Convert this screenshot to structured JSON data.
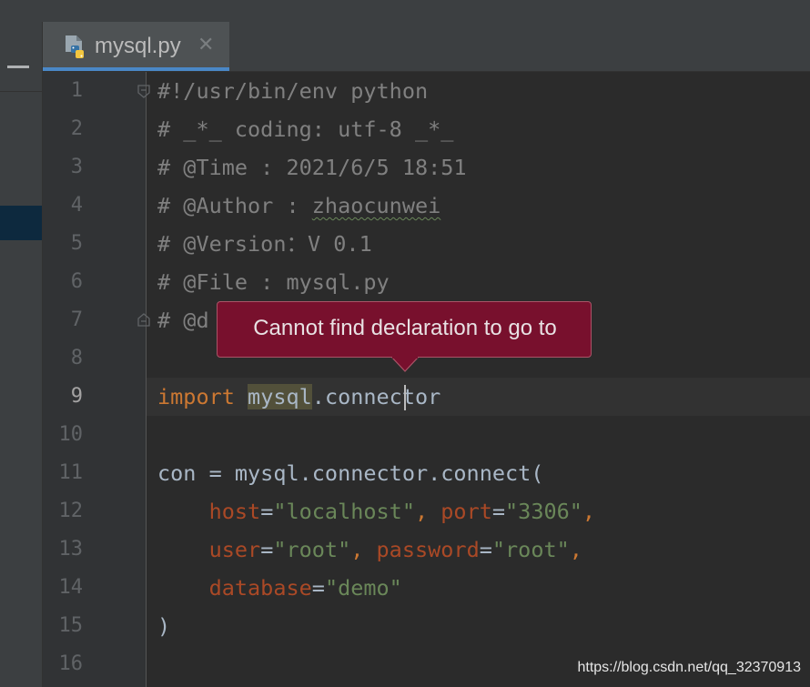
{
  "tab": {
    "label": "mysql.py",
    "close": "✕",
    "icon": "python-file-icon"
  },
  "colors": {
    "comment": "#808080",
    "keyword": "#cc7832",
    "string": "#6a8759",
    "parameter": "#aa4926",
    "default": "#a9b7c6",
    "tooltip_bg": "#78102d",
    "tab_underline": "#4a88c7"
  },
  "editor": {
    "active_line": "9",
    "lines": [
      {
        "n": "1",
        "tokens": [
          {
            "t": "#!/usr/bin/env python",
            "k": "comment"
          }
        ]
      },
      {
        "n": "2",
        "tokens": [
          {
            "t": "# _*_ coding: utf-8 _*_",
            "k": "comment"
          }
        ]
      },
      {
        "n": "3",
        "tokens": [
          {
            "t": "# @Time : 2021/6/5 18:51",
            "k": "comment"
          }
        ]
      },
      {
        "n": "4",
        "tokens": [
          {
            "t": "# @Author : ",
            "k": "comment"
          },
          {
            "t": "zhaocunwei",
            "k": "comment typo"
          }
        ]
      },
      {
        "n": "5",
        "tokens": [
          {
            "t": "# @Version：V 0.1",
            "k": "comment"
          }
        ]
      },
      {
        "n": "6",
        "tokens": [
          {
            "t": "# @File : mysql.py",
            "k": "comment"
          }
        ]
      },
      {
        "n": "7",
        "tokens": [
          {
            "t": "# @d",
            "k": "comment"
          }
        ]
      },
      {
        "n": "8",
        "tokens": []
      },
      {
        "n": "9",
        "tokens": [
          {
            "t": "import",
            "k": "keyword"
          },
          {
            "t": " ",
            "k": "default"
          },
          {
            "t": "mysql",
            "k": "default highlight"
          },
          {
            "t": ".connector",
            "k": "default"
          }
        ]
      },
      {
        "n": "10",
        "tokens": []
      },
      {
        "n": "11",
        "tokens": [
          {
            "t": "con = mysql.connector.connect(",
            "k": "default"
          }
        ]
      },
      {
        "n": "12",
        "tokens": [
          {
            "t": "    ",
            "k": "default"
          },
          {
            "t": "host",
            "k": "param"
          },
          {
            "t": "=",
            "k": "default"
          },
          {
            "t": "\"localhost\"",
            "k": "string"
          },
          {
            "t": ", ",
            "k": "keyword"
          },
          {
            "t": "port",
            "k": "param"
          },
          {
            "t": "=",
            "k": "default"
          },
          {
            "t": "\"3306\"",
            "k": "string"
          },
          {
            "t": ",",
            "k": "keyword"
          }
        ]
      },
      {
        "n": "13",
        "tokens": [
          {
            "t": "    ",
            "k": "default"
          },
          {
            "t": "user",
            "k": "param"
          },
          {
            "t": "=",
            "k": "default"
          },
          {
            "t": "\"root\"",
            "k": "string"
          },
          {
            "t": ", ",
            "k": "keyword"
          },
          {
            "t": "password",
            "k": "param"
          },
          {
            "t": "=",
            "k": "default"
          },
          {
            "t": "\"root\"",
            "k": "string"
          },
          {
            "t": ",",
            "k": "keyword"
          }
        ]
      },
      {
        "n": "14",
        "tokens": [
          {
            "t": "    ",
            "k": "default"
          },
          {
            "t": "database",
            "k": "param"
          },
          {
            "t": "=",
            "k": "default"
          },
          {
            "t": "\"demo\"",
            "k": "string"
          }
        ]
      },
      {
        "n": "15",
        "tokens": [
          {
            "t": ")",
            "k": "default"
          }
        ]
      },
      {
        "n": "16",
        "tokens": []
      }
    ]
  },
  "tooltip": {
    "message": "Cannot find declaration to go to"
  },
  "watermark": "https://blog.csdn.net/qq_32370913"
}
